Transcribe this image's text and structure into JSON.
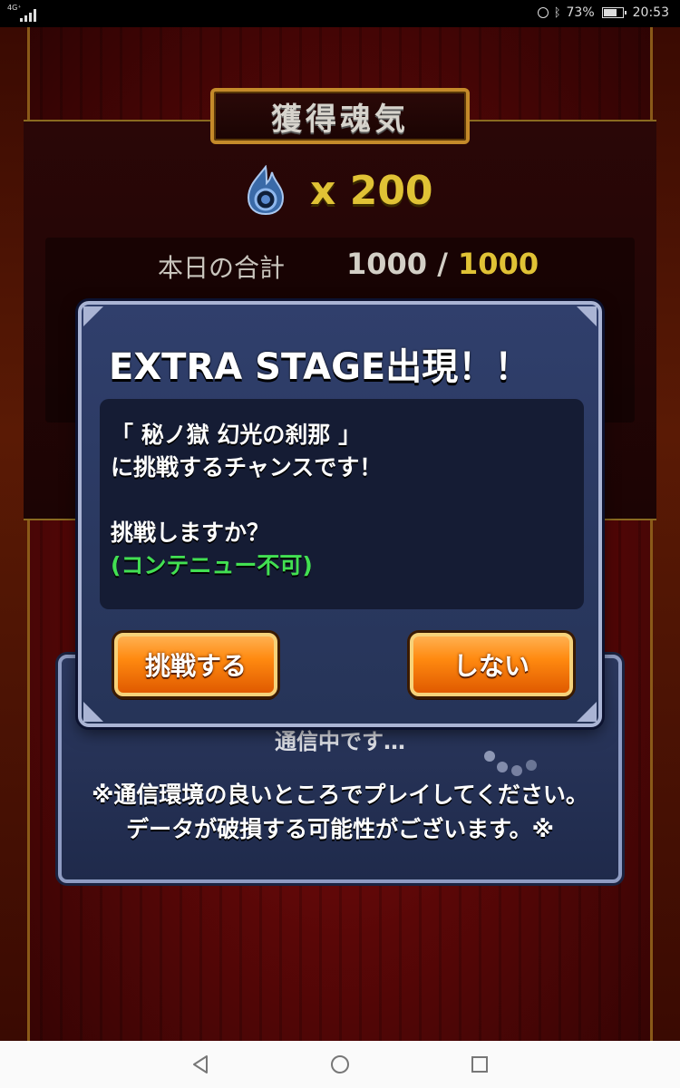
{
  "status_bar": {
    "network_label": "4G⁺",
    "battery_percent": "73%",
    "time": "20:53",
    "icons": [
      "signal-icon",
      "alarm-icon",
      "bluetooth-icon",
      "battery-icon"
    ]
  },
  "result": {
    "title": "獲得魂気",
    "soul_icon": "soul-flame-icon",
    "soul_count": "x 200",
    "today_label": "本日の合計",
    "today_current": "1000",
    "today_separator": " / ",
    "today_max": "1000"
  },
  "connection_dialog": {
    "status_text": "通信中です…",
    "warning_line1": "※通信環境の良いところでプレイしてください。",
    "warning_line2": "データが破損する可能性がございます。※"
  },
  "extra_dialog": {
    "title": "EXTRA STAGE出現！！",
    "line1": "「 秘ノ獄 幻光の刹那 」",
    "line2": "に挑戦するチャンスです！",
    "question": "挑戦しますか？",
    "note": "(コンテニュー不可)",
    "accept_label": "挑戦する",
    "decline_label": "しない"
  },
  "colors": {
    "accent_gold": "#e0c235",
    "button_orange": "#ff8a10",
    "dialog_blue": "#2c3960",
    "note_green": "#42e052"
  },
  "nav_bar": {
    "icons": [
      "back-icon",
      "home-icon",
      "recent-apps-icon"
    ]
  }
}
